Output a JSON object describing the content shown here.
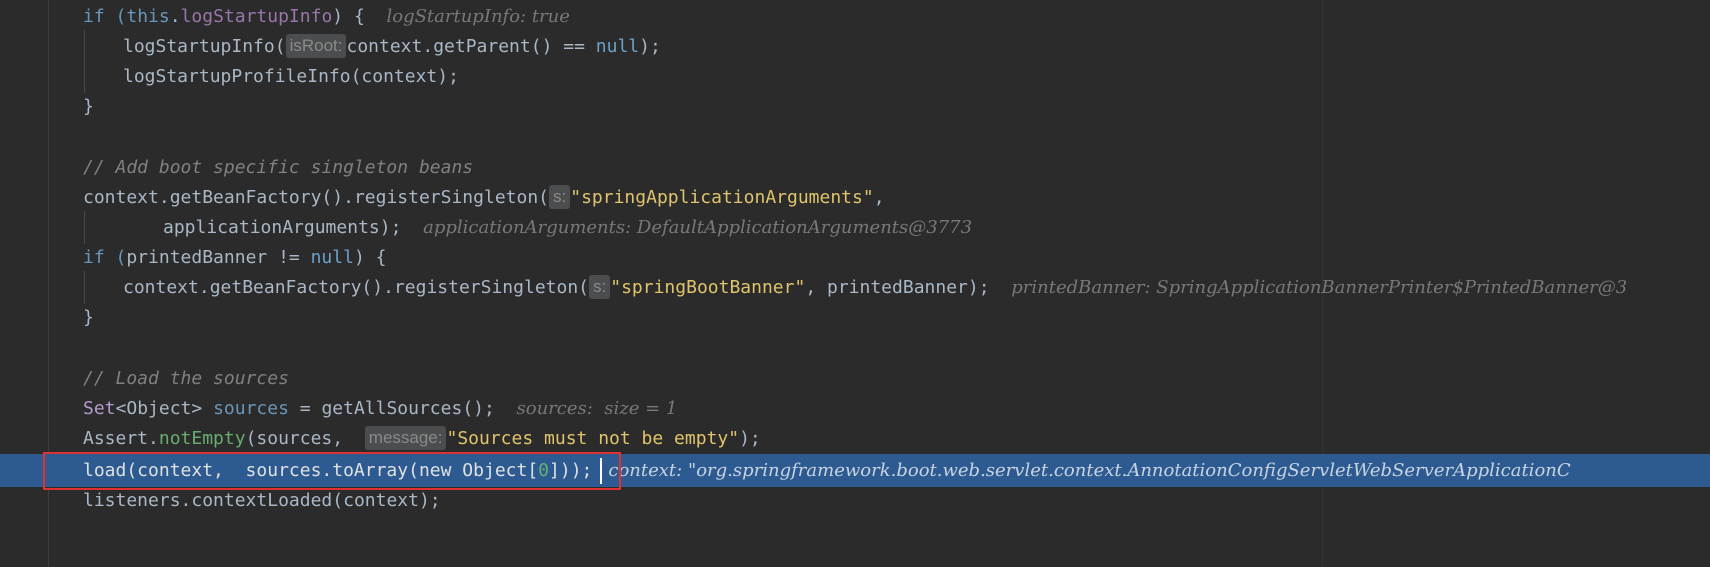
{
  "editor": {
    "lines": [
      {
        "t1": "if (",
        "t2": "this",
        "t3": ".",
        "t4": "logStartupInfo",
        "t5": ") {  ",
        "dbg": "logStartupInfo: true"
      },
      {
        "t1": "logStartupInfo(",
        "hint": "isRoot:",
        "t2": "context.",
        "t3": "getParent",
        "t4": "() == ",
        "t5": "null",
        "t6": ");"
      },
      {
        "t1": "logStartupProfileInfo",
        "t2": "(context);"
      },
      {
        "t1": "}"
      },
      {
        "t1": ""
      },
      {
        "cm": "// Add boot specific singleton beans"
      },
      {
        "t1": "context.",
        "t2": "getBeanFactory",
        "t3": "().",
        "t4": "registerSingleton",
        "t5": "(",
        "hint": "s:",
        "str": "\"springApplicationArguments\"",
        "t6": ","
      },
      {
        "t1": "applicationArguments);  ",
        "dbg": "applicationArguments: DefaultApplicationArguments@3773"
      },
      {
        "t1": "if (",
        "t2": "printedBanner != ",
        "t3": "null",
        "t4": ") {"
      },
      {
        "t1": "context.",
        "t2": "getBeanFactory",
        "t3": "().",
        "t4": "registerSingleton",
        "t5": "(",
        "hint": "s:",
        "str": "\"springBootBanner\"",
        "t6": ", printedBanner);  ",
        "dbg": "printedBanner: SpringApplicationBannerPrinter$PrintedBanner@3"
      },
      {
        "t1": "}"
      },
      {
        "t1": ""
      },
      {
        "cm": "// Load the sources"
      },
      {
        "t1": "Set",
        "t2": "<Object> ",
        "t3": "sources",
        "t4": " = ",
        "t5": "getAllSources",
        "t6": "();  ",
        "dbg": "sources:  size = 1"
      },
      {
        "t1": "Assert.",
        "t2": "notEmpty",
        "t3": "(sources,  ",
        "hint": "message:",
        "str": "\"Sources must not be empty\"",
        "t4": ");"
      },
      {
        "t1": "load(context,  sources.",
        "t2": "toArray",
        "t3": "(",
        "t4": "new",
        "t5": " Object[",
        "t6": "0",
        "t7": "]));",
        "dbg": "context: \"org.springframework.boot.web.servlet.context.AnnotationConfigServletWebServerApplicationC"
      },
      {
        "t1": "listeners.",
        "t2": "contextLoaded",
        "t3": "(context);"
      }
    ]
  }
}
